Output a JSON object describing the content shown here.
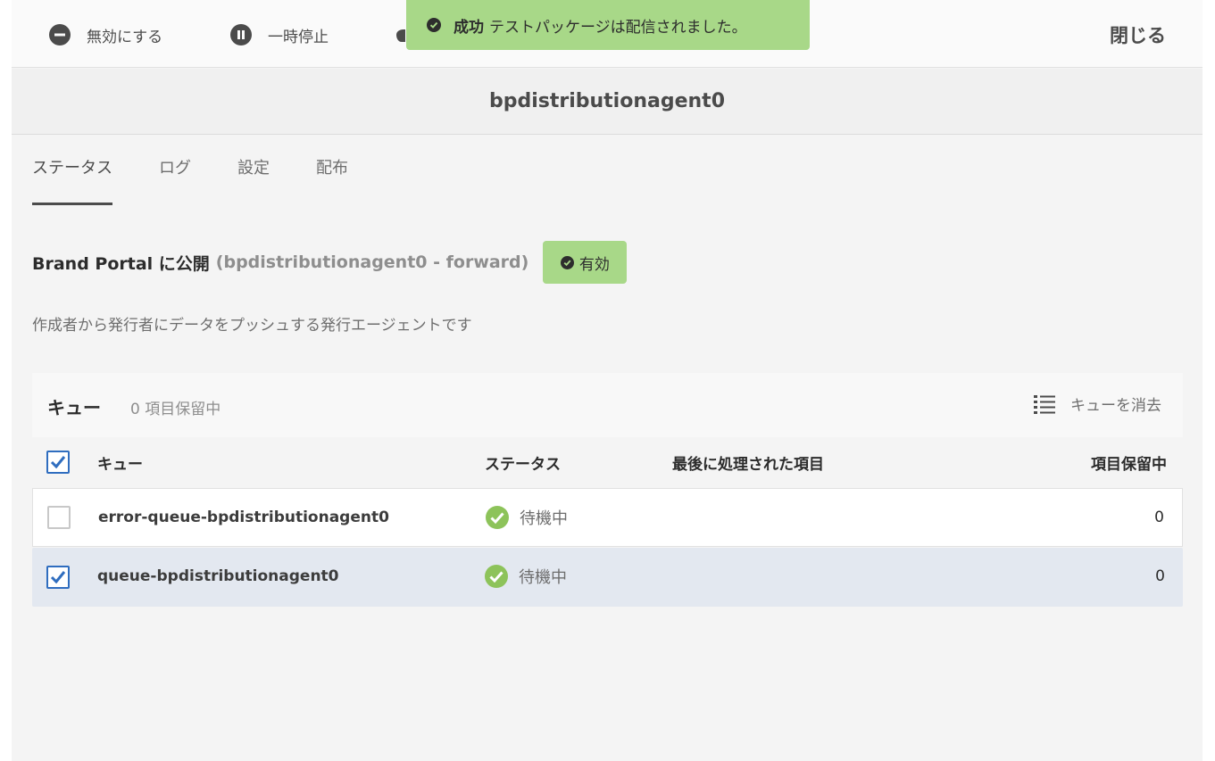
{
  "toolbar": {
    "disable_label": "無効にする",
    "pause_label": "一時停止",
    "close_label": "閉じる"
  },
  "toast": {
    "title": "成功",
    "message": "テストパッケージは配信されました。"
  },
  "agent_name": "bpdistributionagent0",
  "tabs": [
    {
      "label": "ステータス",
      "active": true
    },
    {
      "label": "ログ"
    },
    {
      "label": "設定"
    },
    {
      "label": "配布"
    }
  ],
  "agent": {
    "title": "Brand Portal に公開",
    "subtitle": "(bpdistributionagent0 - forward)",
    "badge": "有効",
    "description": "作成者から発行者にデータをプッシュする発行エージェントです"
  },
  "queue_panel": {
    "title": "キュー",
    "count_text": "0 項目保留中",
    "clear_label": "キューを消去"
  },
  "columns": {
    "queue": "キュー",
    "status": "ステータス",
    "last_processed": "最後に処理された項目",
    "pending": "項目保留中"
  },
  "rows": [
    {
      "name": "error-queue-bpdistributionagent0",
      "status": "待機中",
      "pending": "0",
      "checked": false
    },
    {
      "name": "queue-bpdistributionagent0",
      "status": "待機中",
      "pending": "0",
      "checked": true
    }
  ],
  "colors": {
    "success": "#a8d888",
    "status_ok": "#8dc35a",
    "checkbox_blue": "#2f6dbf",
    "selected_row": "#e3e8f0"
  }
}
